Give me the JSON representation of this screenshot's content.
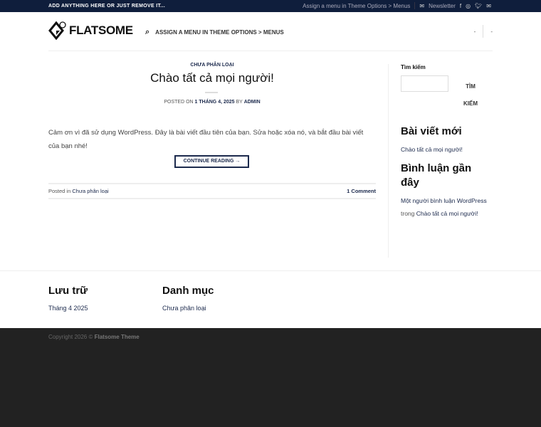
{
  "topbar": {
    "left_text": "ADD ANYTHING HERE OR JUST REMOVE IT...",
    "menu_text": "Assign a menu in Theme Options > Menus",
    "newsletter": "Newsletter",
    "social": [
      "facebook-icon",
      "instagram-icon",
      "twitter-icon",
      "email-icon"
    ]
  },
  "header": {
    "logo": "FLATSOME",
    "nav": "ASSIGN A MENU IN THEME OPTIONS > MENUS",
    "right_items": [
      "-",
      "-"
    ]
  },
  "post": {
    "category": "CHƯA PHÂN LOẠI",
    "title": "Chào tất cả mọi người!",
    "posted_on": "POSTED ON",
    "date": "1 THÁNG 4, 2025",
    "by": "BY",
    "author": "ADMIN",
    "excerpt": "Cảm ơn vì đã sử dụng WordPress. Đây là bài viết đầu tiên của bạn. Sửa hoặc xóa nó, và bắt đầu bài viết của bạn nhé!",
    "continue": "CONTINUE READING →",
    "posted_in": "Posted in",
    "posted_in_cat": "Chưa phân loại",
    "comments": "1 Comment"
  },
  "sidebar": {
    "search_label": "Tìm kiếm",
    "search_btn_1": "TÌM",
    "search_btn_2": "KIẾM",
    "recent_posts_title": "Bài viết mới",
    "recent_post": "Chào tất cả mọi người!",
    "recent_comments_title_1": "Bình luận gần",
    "recent_comments_title_2": "đây",
    "comment_author": "Một người bình luận WordPress",
    "comment_in": "trong",
    "comment_post": "Chào tất cả mọi người!"
  },
  "footer": {
    "archives_title": "Lưu trữ",
    "archive": "Tháng 4 2025",
    "categories_title": "Danh mục",
    "category": "Chưa phân loại",
    "copyright": "Copyright 2026 ©",
    "theme": "Flatsome Theme"
  },
  "colors": {
    "primary": "#0f1e3c",
    "link": "#1c2a4d",
    "copyright_bg": "#222222"
  }
}
